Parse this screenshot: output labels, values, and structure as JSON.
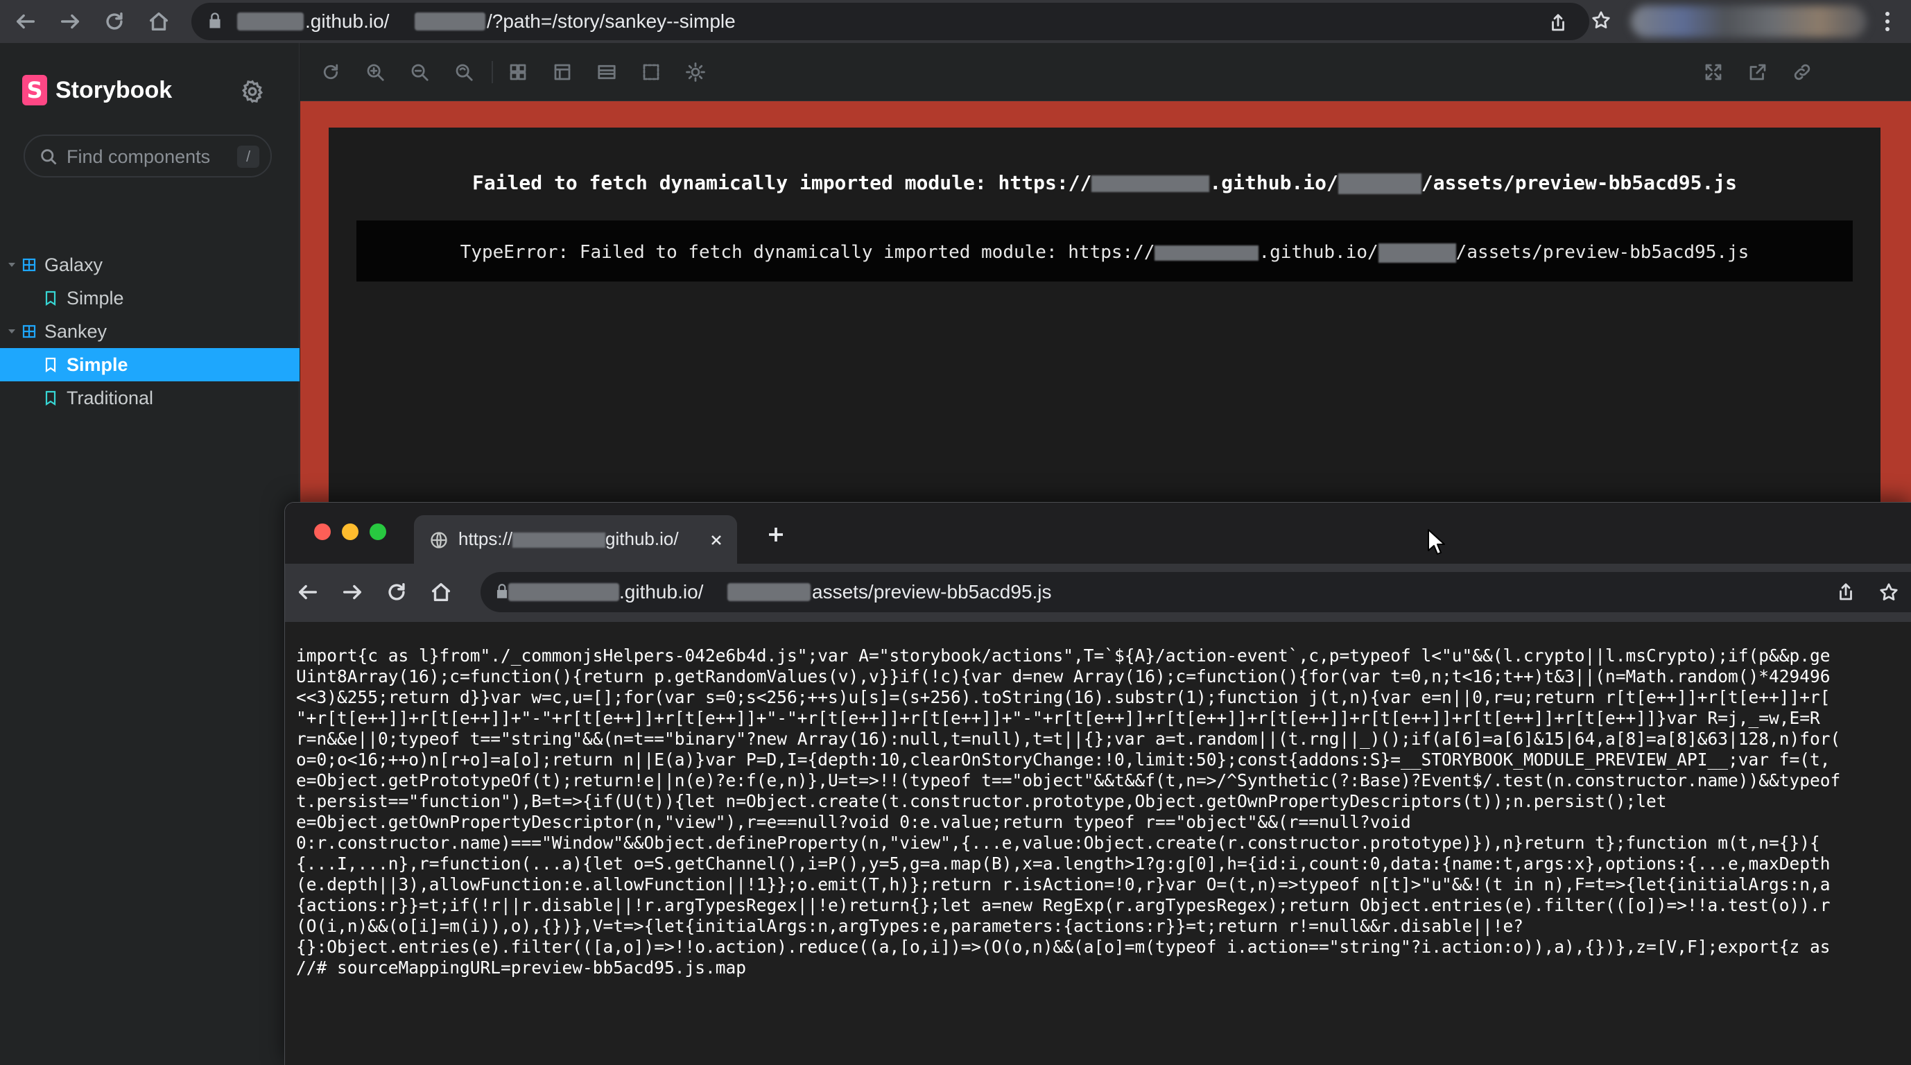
{
  "browser": {
    "url_segments": [
      ".github.io/",
      "/?path=/story/sankey--simple"
    ]
  },
  "sidebar": {
    "brand": "Storybook",
    "brand_mark": "S",
    "search": {
      "placeholder": "Find components",
      "shortcut": "/"
    },
    "tree": [
      {
        "type": "component",
        "label": "Galaxy",
        "expanded": true
      },
      {
        "type": "story",
        "label": "Simple",
        "selected": false
      },
      {
        "type": "component",
        "label": "Sankey",
        "expanded": true
      },
      {
        "type": "story",
        "label": "Simple",
        "selected": true
      },
      {
        "type": "story",
        "label": "Traditional",
        "selected": false
      }
    ]
  },
  "toolbar": {
    "left_icons": [
      "reload-icon",
      "zoom-in-icon",
      "zoom-out-icon",
      "zoom-reset-icon",
      "grid-icon",
      "background-icon",
      "viewport-icon",
      "outline-icon",
      "measure-icon"
    ],
    "right_icons": [
      "fullscreen-icon",
      "open-new-tab-icon",
      "copy-link-icon"
    ]
  },
  "error": {
    "title_prefix": "Failed to fetch dynamically imported module: https://",
    "title_mid": ".github.io/",
    "title_suffix": "/assets/preview-bb5acd95.js",
    "stack_prefix": "TypeError: Failed to fetch dynamically imported module: https://",
    "stack_mid": ".github.io/",
    "stack_suffix": "/assets/preview-bb5acd95.js"
  },
  "second_window": {
    "tab_title_prefix": "https://",
    "tab_title_suffix": "github.io/",
    "url_segments": [
      ".github.io/",
      "assets/preview-bb5acd95.js"
    ],
    "code_lines": [
      "import{c as l}from\"./_commonjsHelpers-042e6b4d.js\";var A=\"storybook/actions\",T=`${A}/action-event`,c,p=typeof l<\"u\"&&(l.crypto||l.msCrypto);if(p&&p.ge",
      "Uint8Array(16);c=function(){return p.getRandomValues(v),v}}if(!c){var d=new Array(16);c=function(){for(var t=0,n;t<16;t++)t&3||(n=Math.random()*429496",
      "<<3)&255;return d}}var w=c,u=[];for(var s=0;s<256;++s)u[s]=(s+256).toString(16).substr(1);function j(t,n){var e=n||0,r=u;return r[t[e++]]+r[t[e++]]+r[",
      "\"+r[t[e++]]+r[t[e++]]+\"-\"+r[t[e++]]+r[t[e++]]+\"-\"+r[t[e++]]+r[t[e++]]+\"-\"+r[t[e++]]+r[t[e++]]+r[t[e++]]+r[t[e++]]+r[t[e++]]+r[t[e++]]}var R=j,_=w,E=R",
      "r=n&&e||0;typeof t==\"string\"&&(n=t==\"binary\"?new Array(16):null,t=null),t=t||{};var a=t.random||(t.rng||_)();if(a[6]=a[6]&15|64,a[8]=a[8]&63|128,n)for(",
      "o=0;o<16;++o)n[r+o]=a[o];return n||E(a)}var P=D,I={depth:10,clearOnStoryChange:!0,limit:50};const{addons:S}=__STORYBOOK_MODULE_PREVIEW_API__;var f=(t,",
      "e=Object.getPrototypeOf(t);return!e||n(e)?e:f(e,n)},U=t=>!!(typeof t==\"object\"&&t&&f(t,n=>/^Synthetic(?:Base)?Event$/.test(n.constructor.name))&&typeof",
      "t.persist==\"function\"),B=t=>{if(U(t)){let n=Object.create(t.constructor.prototype,Object.getOwnPropertyDescriptors(t));n.persist();let",
      "e=Object.getOwnPropertyDescriptor(n,\"view\"),r=e==null?void 0:e.value;return typeof r==\"object\"&&(r==null?void",
      "0:r.constructor.name)===\"Window\"&&Object.defineProperty(n,\"view\",{...e,value:Object.create(r.constructor.prototype)}),n}return t};function m(t,n={}){",
      "{...I,...n},r=function(...a){let o=S.getChannel(),i=P(),y=5,g=a.map(B),x=a.length>1?g:g[0],h={id:i,count:0,data:{name:t,args:x},options:{...e,maxDepth",
      "(e.depth||3),allowFunction:e.allowFunction||!1}};o.emit(T,h)};return r.isAction=!0,r}var O=(t,n)=>typeof n[t]>\"u\"&&!(t in n),F=t=>{let{initialArgs:n,a",
      "{actions:r}}=t;if(!r||r.disable||!r.argTypesRegex||!e)return{};let a=new RegExp(r.argTypesRegex);return Object.entries(e).filter(([o])=>!!a.test(o)).r",
      "(O(i,n)&&(o[i]=m(i)),o),{})},V=t=>{let{initialArgs:n,argTypes:e,parameters:{actions:r}}=t;return r!=null&&r.disable||!e?",
      "{}:Object.entries(e).filter(([a,o])=>!!o.action).reduce((a,[o,i])=>(O(o,n)&&(a[o]=m(typeof i.action==\"string\"?i.action:o)),a),{})},z=[V,F];export{z as",
      "//# sourceMappingURL=preview-bb5acd95.js.map"
    ]
  },
  "colors": {
    "storybook_accent": "#ff4785",
    "selection": "#1ea7fd",
    "error_border": "#b23a2c"
  }
}
